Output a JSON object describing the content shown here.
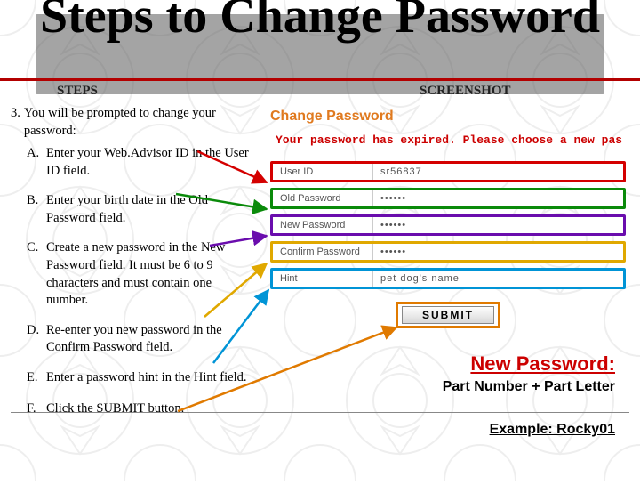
{
  "title": "Steps to Change Password",
  "columns": {
    "steps": "STEPS",
    "shots": "SCREENSHOT"
  },
  "step": {
    "num": "3.",
    "text": "You will be prompted to change your password:",
    "subs": {
      "a": {
        "lt": "A.",
        "tx": "Enter your Web.Advisor ID in the User ID field."
      },
      "b": {
        "lt": "B.",
        "tx": "Enter your birth date in the Old Password field."
      },
      "c": {
        "lt": "C.",
        "tx": "Create a new password in the New Password field.  It must be 6 to 9 characters and must contain one number."
      },
      "d": {
        "lt": "D.",
        "tx": "Re-enter you new password in the Confirm Password field."
      },
      "e": {
        "lt": "E.",
        "tx": "Enter a password hint in the Hint field."
      },
      "f": {
        "lt": "F.",
        "tx": "Click the SUBMIT button."
      }
    }
  },
  "form": {
    "title": "Change Password",
    "message": "Your password has expired.  Please choose a new pas",
    "fields": {
      "user": {
        "label": "User ID",
        "value": "sr56837"
      },
      "old": {
        "label": "Old Password",
        "value": "••••••"
      },
      "new": {
        "label": "New Password",
        "value": "••••••"
      },
      "confirm": {
        "label": "Confirm Password",
        "value": "••••••"
      },
      "hint": {
        "label": "Hint",
        "value": "pet dog's name"
      }
    },
    "submit": "SUBMIT"
  },
  "callout": {
    "line1": "New Password:",
    "line2": "Part Number + Part Letter",
    "line3": "Example: Rocky01"
  },
  "colors": {
    "red": "#d40000",
    "green": "#0a8a0a",
    "purple": "#6a0dad",
    "gold": "#e0a800",
    "blue": "#0094d6",
    "orange": "#e07a00"
  }
}
